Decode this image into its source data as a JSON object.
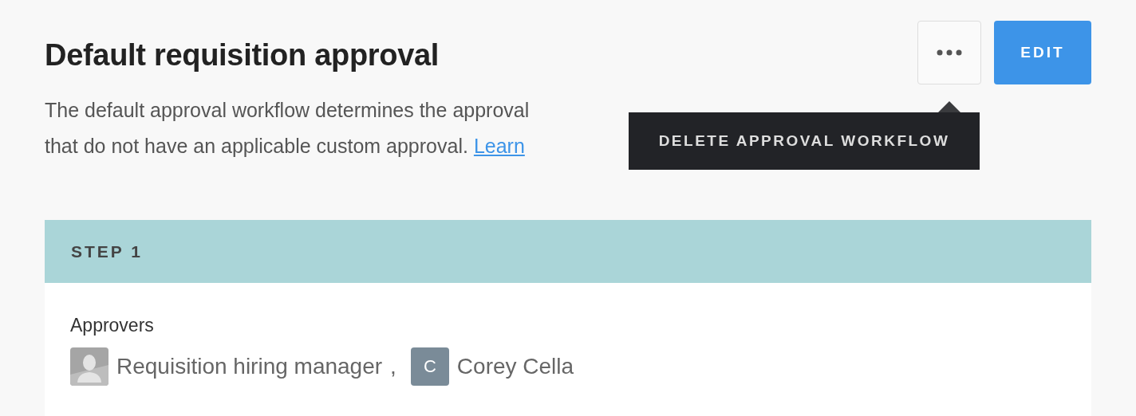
{
  "title": "Default requisition approval",
  "actions": {
    "edit_button": "EDIT"
  },
  "tooltip": "DELETE APPROVAL WORKFLOW",
  "description": {
    "lines": [
      "The default approval workflow determines the approval",
      "that do not have an applicable custom approval."
    ],
    "link": "Learn"
  },
  "step": {
    "header": "STEP 1",
    "approvers_label": "Approvers",
    "approvers": [
      {
        "kind": "role",
        "name": "Requisition hiring manager",
        "separator": ","
      },
      {
        "kind": "person",
        "initial": "C",
        "name": "Corey Cella"
      }
    ]
  }
}
